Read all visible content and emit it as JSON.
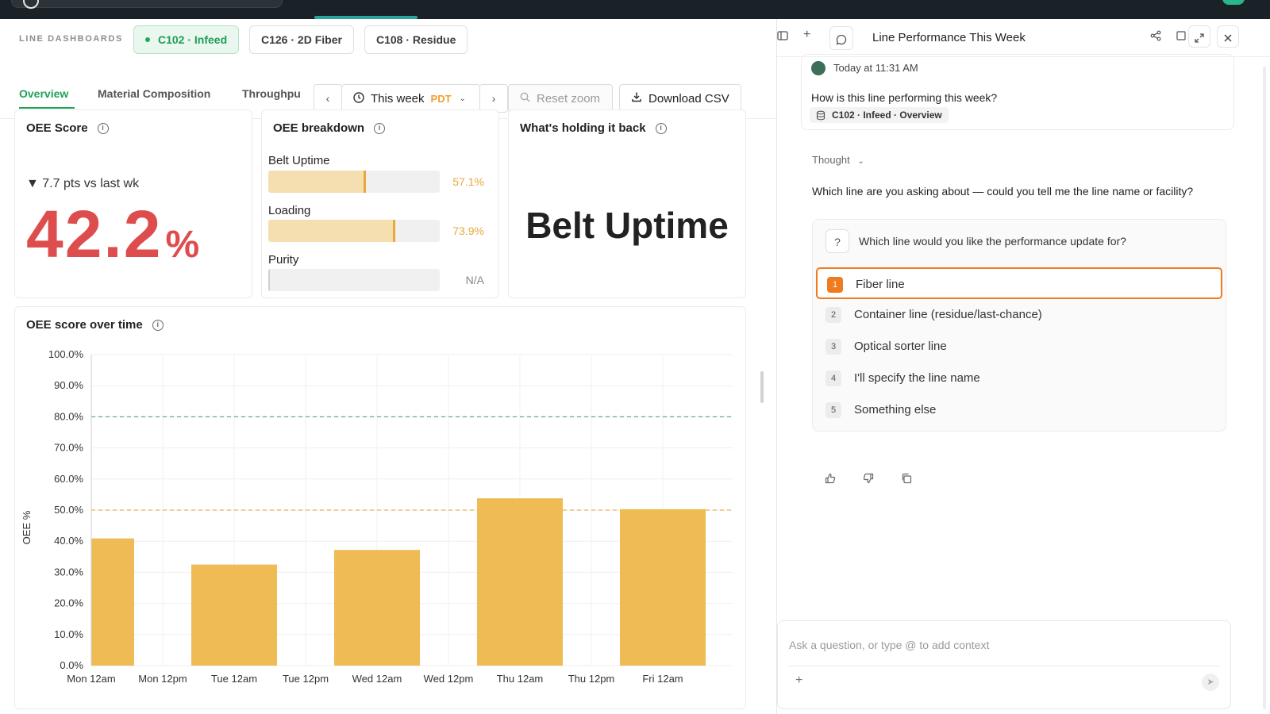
{
  "line_tabs": {
    "label": "LINE DASHBOARDS",
    "items": [
      {
        "label": "C102 · Infeed",
        "active": true
      },
      {
        "label": "C126 · 2D Fiber",
        "active": false
      },
      {
        "label": "C108 · Residue",
        "active": false
      }
    ]
  },
  "sub_tabs": [
    {
      "label": "Overview",
      "active": true
    },
    {
      "label": "Material Composition",
      "active": false
    },
    {
      "label": "Throughpu",
      "active": false
    }
  ],
  "controls": {
    "prev": "‹",
    "next": "›",
    "range_label": "This week",
    "timezone": "PDT",
    "reset_zoom": "Reset zoom",
    "download": "Download CSV"
  },
  "oee_score": {
    "title": "OEE Score",
    "delta": "▼ 7.7 pts vs last wk",
    "value": "42.2",
    "unit": "%"
  },
  "oee_breakdown": {
    "title": "OEE breakdown",
    "items": [
      {
        "label": "Belt Uptime",
        "value_text": "57.1%",
        "fraction": 0.571
      },
      {
        "label": "Loading",
        "value_text": "73.9%",
        "fraction": 0.739
      },
      {
        "label": "Purity",
        "value_text": "N/A",
        "fraction": 0
      }
    ]
  },
  "holding_back": {
    "title": "What's holding it back",
    "value": "Belt Uptime"
  },
  "chart_title": "OEE score over time",
  "chart_data": {
    "type": "bar",
    "title": "OEE score over time",
    "ylabel": "OEE %",
    "xlabel": "",
    "ylim": [
      0,
      100
    ],
    "y_ticks": [
      "0.0%",
      "10.0%",
      "20.0%",
      "30.0%",
      "40.0%",
      "50.0%",
      "60.0%",
      "70.0%",
      "80.0%",
      "90.0%",
      "100.0%"
    ],
    "x_ticks": [
      "Mon 12am",
      "Mon 12pm",
      "Tue 12am",
      "Tue 12pm",
      "Wed 12am",
      "Wed 12pm",
      "Thu 12am",
      "Thu 12pm",
      "Fri 12am"
    ],
    "categories": [
      "Mon",
      "Tue",
      "Wed",
      "Thu",
      "Fri"
    ],
    "values": [
      40.9,
      32.5,
      37.2,
      53.8,
      50.3
    ],
    "reference_lines": [
      {
        "value": 80,
        "color": "#5fa7a2"
      },
      {
        "value": 50,
        "color": "#e8b45a"
      }
    ],
    "bar_color": "#eebb55",
    "grid": true
  },
  "chat": {
    "title": "Line Performance This Week",
    "timestamp": "Today at 11:31 AM",
    "question": "How is this line performing this week?",
    "context": "C102 · Infeed · Overview",
    "thought_label": "Thought",
    "answer": "Which line are you asking about — could you tell me the line name or facility?",
    "prompt_title": "Which line would you like the performance update for?",
    "options": [
      {
        "num": "1",
        "label": "Fiber line"
      },
      {
        "num": "2",
        "label": "Container line (residue/last-chance)"
      },
      {
        "num": "3",
        "label": "Optical sorter line"
      },
      {
        "num": "4",
        "label": "I'll specify the line name"
      },
      {
        "num": "5",
        "label": "Something else"
      }
    ],
    "composer_placeholder": "Ask a question, or type @ to add context"
  },
  "icons": {
    "clock": "clock-icon",
    "search": "search-icon",
    "download": "download-icon",
    "info": "info-icon"
  }
}
